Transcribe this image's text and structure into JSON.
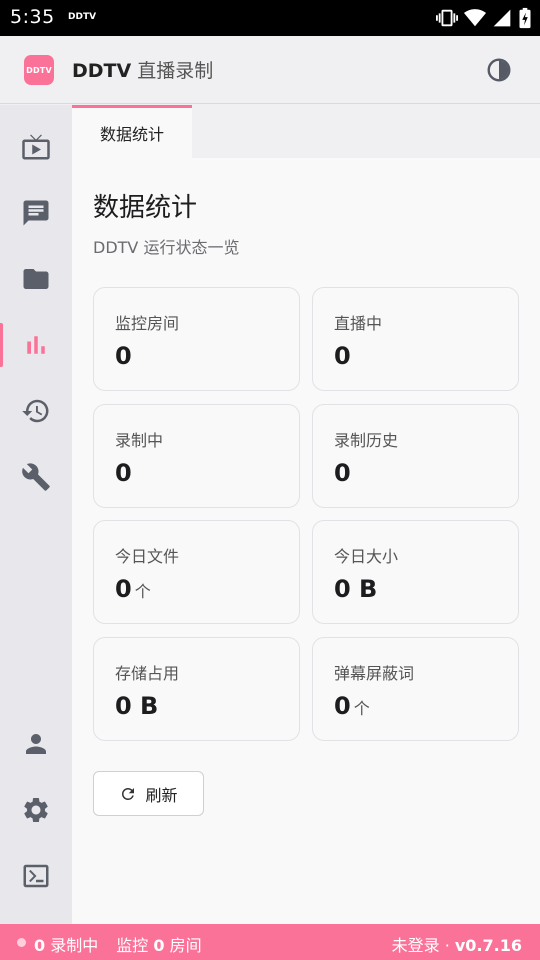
{
  "status_bar": {
    "time": "5:35",
    "app_label": "DDTV"
  },
  "app_bar": {
    "logo_text": "DDTV",
    "title_bold": "DDTV",
    "title_rest": "直播录制",
    "theme_icon": "contrast-icon"
  },
  "sidebar": {
    "top_items": [
      {
        "name": "live-tv-icon",
        "active": false
      },
      {
        "name": "chat-icon",
        "active": false
      },
      {
        "name": "folder-icon",
        "active": false
      },
      {
        "name": "bar-chart-icon",
        "active": true
      },
      {
        "name": "history-icon",
        "active": false
      },
      {
        "name": "wrench-icon",
        "active": false
      }
    ],
    "bottom_items": [
      {
        "name": "user-icon"
      },
      {
        "name": "gear-icon"
      },
      {
        "name": "terminal-icon"
      }
    ]
  },
  "tabs": [
    {
      "label": "数据统计",
      "active": true
    }
  ],
  "page": {
    "title": "数据统计",
    "subtitle": "DDTV 运行状态一览"
  },
  "stats": [
    {
      "label": "监控房间",
      "value": "0",
      "unit": ""
    },
    {
      "label": "直播中",
      "value": "0",
      "unit": ""
    },
    {
      "label": "录制中",
      "value": "0",
      "unit": ""
    },
    {
      "label": "录制历史",
      "value": "0",
      "unit": ""
    },
    {
      "label": "今日文件",
      "value": "0",
      "unit": "个"
    },
    {
      "label": "今日大小",
      "value": "0 B",
      "unit": ""
    },
    {
      "label": "存储占用",
      "value": "0 B",
      "unit": ""
    },
    {
      "label": "弹幕屏蔽词",
      "value": "0",
      "unit": "个"
    }
  ],
  "refresh": {
    "label": "刷新"
  },
  "footer": {
    "recording_count": "0",
    "recording_label": "录制中",
    "monitor_prefix": "监控",
    "monitor_count": "0",
    "monitor_suffix": "房间",
    "login_status": "未登录",
    "separator": "·",
    "version": "v0.7.16"
  },
  "colors": {
    "accent": "#fb7299",
    "icon": "#5a5f6a"
  }
}
